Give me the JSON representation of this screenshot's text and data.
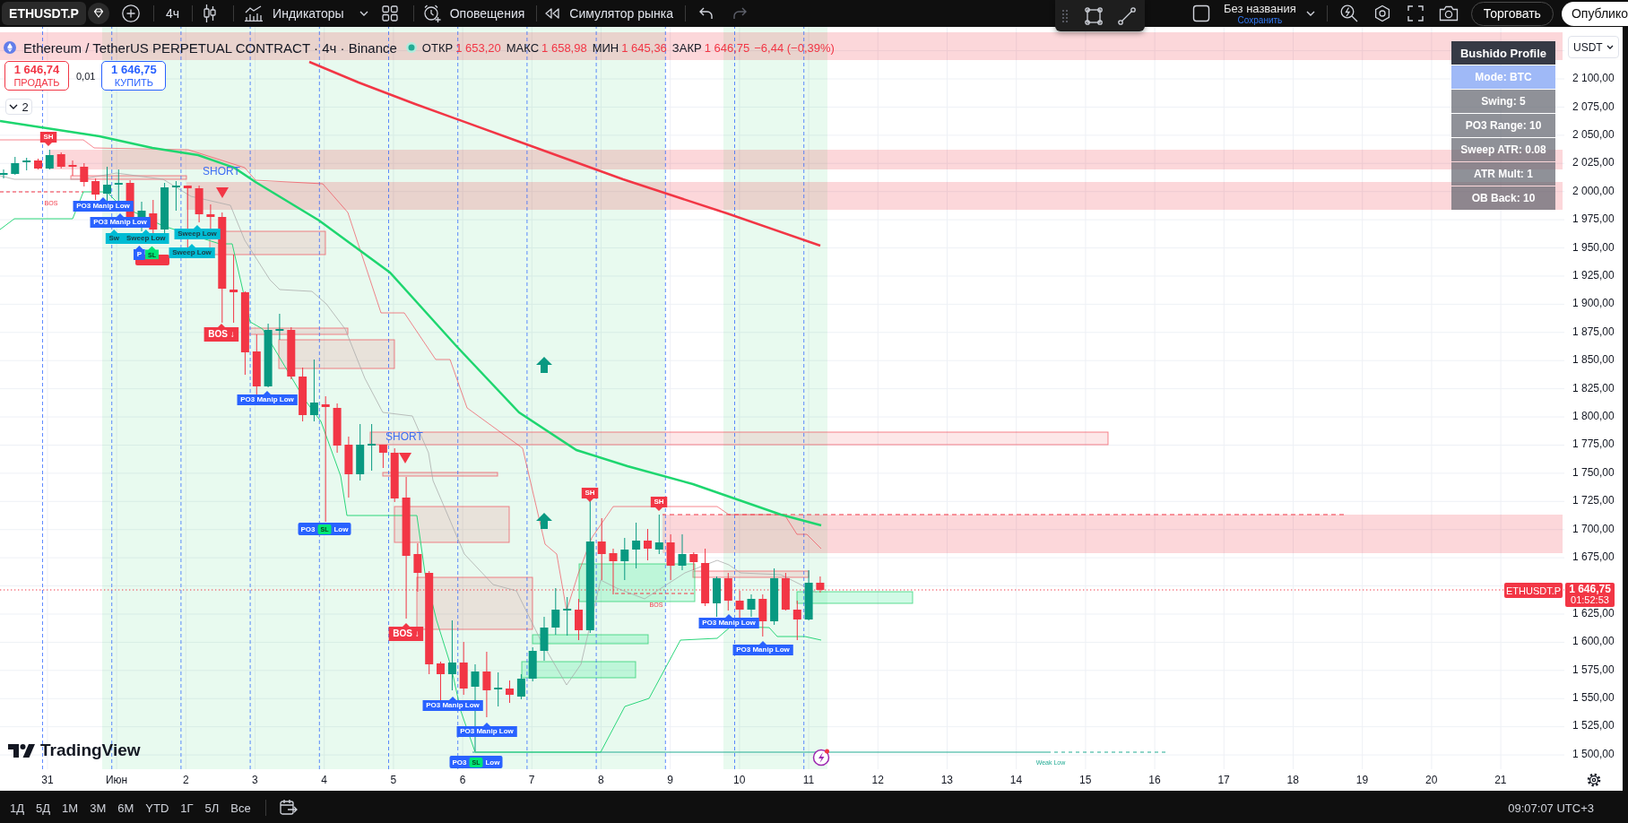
{
  "toolbar": {
    "symbol": "ETHUSDT.P",
    "interval": "4ч",
    "indicators": "Индикаторы",
    "alerts": "Оповещения",
    "replay": "Симулятор рынка",
    "undo": {
      "disabled": false
    },
    "redo": {
      "disabled": true
    },
    "layout_name": "Без названия",
    "save": "Сохранить",
    "trade": "Торговать",
    "publish": "Опублико"
  },
  "legend": {
    "title": "Ethereum / TetherUS PERPETUAL CONTRACT · 4ч · Binance",
    "ohlc": [
      {
        "label": "ОТКР",
        "value": "1 653,20"
      },
      {
        "label": "МАКС",
        "value": "1 658,98"
      },
      {
        "label": "МИН",
        "value": "1 645,36"
      },
      {
        "label": "ЗАКР",
        "value": "1 646,75"
      }
    ],
    "change": "−6,44 (−0,39%)",
    "falling": true
  },
  "order_panel": {
    "sell": {
      "price": "1 646,74",
      "label": "ПРОДАТЬ"
    },
    "spread": "0,01",
    "buy": {
      "price": "1 646,75",
      "label": "КУПИТЬ"
    }
  },
  "indicator_toggle": {
    "count": "2"
  },
  "annotations": [
    {
      "kind": "swing-high",
      "text": "SH"
    },
    {
      "kind": "bos-text",
      "text": "BOS"
    },
    {
      "kind": "po3",
      "text": "PO3 Manip Low"
    },
    {
      "kind": "po3",
      "text": "PO3 Manip Low"
    },
    {
      "kind": "sweep",
      "text": "Sw"
    },
    {
      "kind": "sweep",
      "text": "Sweep Low"
    },
    {
      "kind": "po3",
      "text": "P"
    },
    {
      "kind": "sl",
      "text": "SL"
    },
    {
      "kind": "sweep",
      "text": "Sweep Low"
    },
    {
      "kind": "sweep",
      "text": "Sweep Low"
    },
    {
      "kind": "short",
      "text": "SHORT"
    },
    {
      "kind": "bos",
      "text": "BOS ↓"
    },
    {
      "kind": "po3",
      "text": "PO3 Manip Low"
    },
    {
      "kind": "po3-sl",
      "parts": [
        "PO3",
        "SL",
        "Low"
      ]
    },
    {
      "kind": "short",
      "text": "SHORT"
    },
    {
      "kind": "bos",
      "text": "BOS ↓"
    },
    {
      "kind": "po3",
      "text": "PO3 Manip Low"
    },
    {
      "kind": "po3",
      "text": "PO3 Manip Low"
    },
    {
      "kind": "po3-sl",
      "parts": [
        "PO3",
        "SL",
        "Low"
      ]
    },
    {
      "kind": "swing-high",
      "text": "SH"
    },
    {
      "kind": "swing-high",
      "text": "SH"
    },
    {
      "kind": "bos-text",
      "text": "BOS"
    },
    {
      "kind": "po3",
      "text": "PO3 Manip Low"
    },
    {
      "kind": "po3",
      "text": "PO3 Manip Low"
    },
    {
      "kind": "weak-low",
      "text": "Weak Low"
    }
  ],
  "profile_table": {
    "title": "Bushido Profile",
    "rows": [
      {
        "kind": "mode",
        "text": "Mode: BTC"
      },
      {
        "kind": "param",
        "text": "Swing: 5"
      },
      {
        "kind": "param",
        "text": "PO3 Range: 10"
      },
      {
        "kind": "param",
        "text": "Sweep ATR: 0.08"
      },
      {
        "kind": "param",
        "text": "ATR Mult: 1"
      },
      {
        "kind": "param",
        "text": "OB Back: 10"
      }
    ]
  },
  "branding": {
    "logo_text": "TradingView"
  },
  "last_price": {
    "symbol": "ETHUSDT.P",
    "price": "1 646,75",
    "countdown": "01:52:53"
  },
  "price_axis": {
    "currency": "USDT",
    "ticks": [
      "2 100,00",
      "2 075,00",
      "2 050,00",
      "2 025,00",
      "2 000,00",
      "1 975,00",
      "1 950,00",
      "1 925,00",
      "1 900,00",
      "1 875,00",
      "1 850,00",
      "1 825,00",
      "1 800,00",
      "1 775,00",
      "1 750,00",
      "1 725,00",
      "1 700,00",
      "1 675,00",
      "1 625,00",
      "1 600,00",
      "1 575,00",
      "1 550,00",
      "1 525,00",
      "1 500,00"
    ]
  },
  "time_axis": {
    "labels": [
      "31",
      "Июн",
      "2",
      "3",
      "4",
      "5",
      "6",
      "7",
      "8",
      "9",
      "10",
      "11",
      "12",
      "13",
      "14",
      "15",
      "16",
      "17",
      "18",
      "19",
      "20",
      "21"
    ]
  },
  "bottom_bar": {
    "ranges": [
      "1Д",
      "5Д",
      "1М",
      "3М",
      "6М",
      "YTD",
      "1Г",
      "5Л",
      "Все"
    ],
    "clock": "09:07:07 UTC+3"
  }
}
